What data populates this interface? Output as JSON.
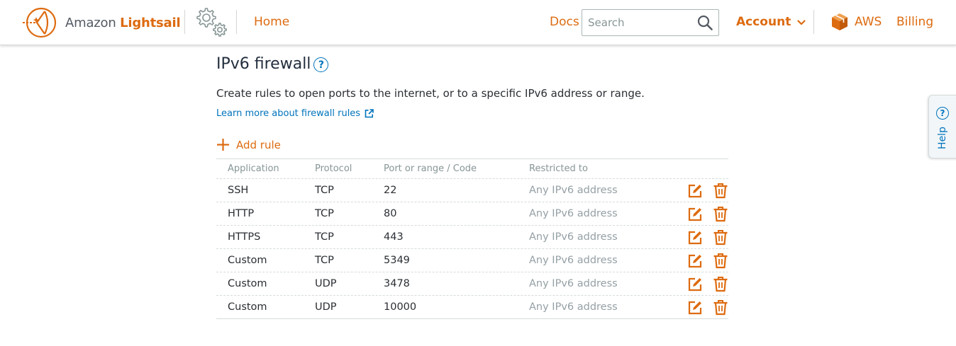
{
  "nav": {
    "brand_prefix": "Amazon",
    "brand_name": "Lightsail",
    "home": "Home",
    "docs": "Docs",
    "search_placeholder": "Search",
    "account": "Account",
    "aws": "AWS",
    "billing": "Billing"
  },
  "page": {
    "title": "IPv6 firewall",
    "help_symbol": "?",
    "description": "Create rules to open ports to the internet, or to a specific IPv6 address or range.",
    "learn_more": "Learn more about firewall rules",
    "add_rule": "Add rule"
  },
  "table": {
    "headers": [
      "Application",
      "Protocol",
      "Port or range / Code",
      "Restricted to"
    ],
    "rows": [
      {
        "application": "SSH",
        "protocol": "TCP",
        "port": "22",
        "restricted": "Any IPv6 address"
      },
      {
        "application": "HTTP",
        "protocol": "TCP",
        "port": "80",
        "restricted": "Any IPv6 address"
      },
      {
        "application": "HTTPS",
        "protocol": "TCP",
        "port": "443",
        "restricted": "Any IPv6 address"
      },
      {
        "application": "Custom",
        "protocol": "TCP",
        "port": "5349",
        "restricted": "Any IPv6 address"
      },
      {
        "application": "Custom",
        "protocol": "UDP",
        "port": "3478",
        "restricted": "Any IPv6 address"
      },
      {
        "application": "Custom",
        "protocol": "UDP",
        "port": "10000",
        "restricted": "Any IPv6 address"
      }
    ]
  },
  "help_tab": {
    "symbol": "?",
    "label": "Help"
  },
  "icons": {
    "logo": "lightsail-logo-icon",
    "gear": "settings-gear-icon",
    "search": "search-icon",
    "account_chevron": "chevron-down-icon",
    "aws": "aws-cube-icon",
    "external": "external-link-icon",
    "add": "plus-icon",
    "edit": "edit-icon",
    "delete": "trash-icon"
  },
  "colors": {
    "accent": "#dd6b10",
    "link": "#0073bb",
    "text": "#232f3e",
    "muted": "#879596"
  }
}
